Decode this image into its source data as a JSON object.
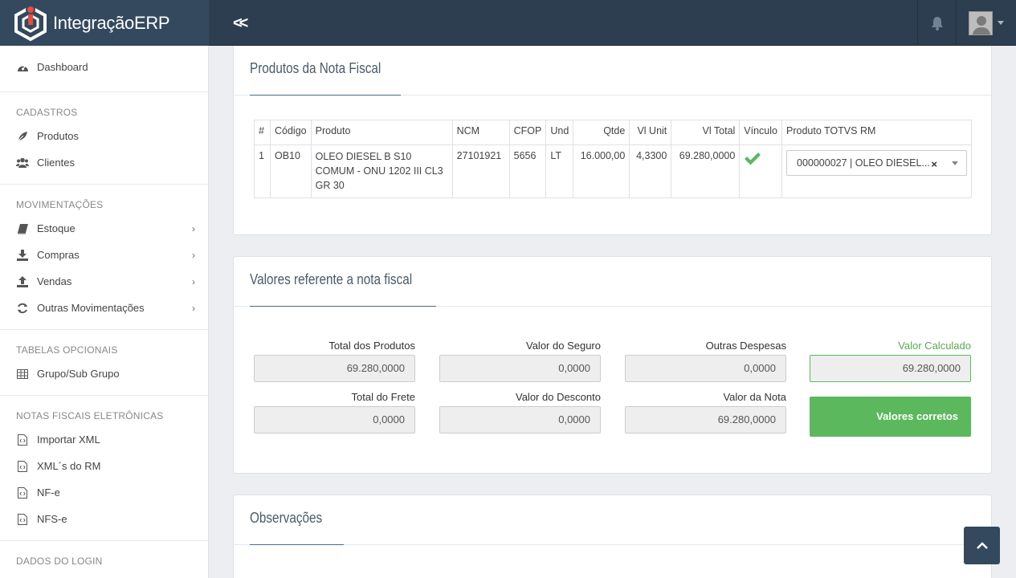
{
  "app": {
    "brand": "IntegraçãoERP",
    "collapse_label": "«"
  },
  "sidebar": {
    "dashboard": "Dashboard",
    "sections": [
      {
        "title": "CADASTROS",
        "items": [
          {
            "label": "Produtos",
            "icon": "leaf-icon"
          },
          {
            "label": "Clientes",
            "icon": "users-icon"
          }
        ]
      },
      {
        "title": "MOVIMENTAÇÕES",
        "items": [
          {
            "label": "Estoque",
            "icon": "book-icon"
          },
          {
            "label": "Compras",
            "icon": "download-icon"
          },
          {
            "label": "Vendas",
            "icon": "upload-icon"
          },
          {
            "label": "Outras Movimentações",
            "icon": "refresh-icon"
          }
        ]
      },
      {
        "title": "TABELAS OPCIONAIS",
        "items": [
          {
            "label": "Grupo/Sub Grupo",
            "icon": "table-icon"
          }
        ]
      },
      {
        "title": "NOTAS FISCAIS ELETRÔNICAS",
        "items": [
          {
            "label": "Importar XML",
            "icon": "file-code-icon"
          },
          {
            "label": "XML´s do RM",
            "icon": "file-code-icon"
          },
          {
            "label": "NF-e",
            "icon": "file-code-icon"
          },
          {
            "label": "NFS-e",
            "icon": "file-code-icon"
          }
        ]
      },
      {
        "title": "DADOS DO LOGIN"
      }
    ]
  },
  "produtos": {
    "title": "Produtos da Nota Fiscal",
    "headers": [
      "#",
      "Código",
      "Produto",
      "NCM",
      "CFOP",
      "Und",
      "Qtde",
      "Vl Unit",
      "Vl Total",
      "Vínculo",
      "Produto TOTVS RM"
    ],
    "row": {
      "num": "1",
      "codigo": "OB10",
      "produto": "OLEO DIESEL B S10 COMUM - ONU 1202 III CL3 GR 30",
      "ncm": "27101921",
      "cfop": "5656",
      "und": "LT",
      "qtde": "16.000,00",
      "vl_unit": "4,3300",
      "vl_total": "69.280,0000",
      "vinculo": "check",
      "totvs": "000000027 | OLEO DIESEL...",
      "clear": "×"
    }
  },
  "valores": {
    "title": "Valores referente a nota fiscal",
    "total_produtos_label": "Total dos Produtos",
    "total_produtos": "69.280,0000",
    "valor_seguro_label": "Valor do Seguro",
    "valor_seguro": "0,0000",
    "outras_despesas_label": "Outras Despesas",
    "outras_despesas": "0,0000",
    "valor_calculado_label": "Valor Calculado",
    "valor_calculado": "69.280,0000",
    "total_frete_label": "Total do Frete",
    "total_frete": "0,0000",
    "valor_desconto_label": "Valor do Desconto",
    "valor_desconto": "0,0000",
    "valor_nota_label": "Valor da Nota",
    "valor_nota": "69.280,0000",
    "ok_button": "Valores corretos"
  },
  "observacoes": {
    "title": "Observações"
  },
  "colors": {
    "accent_green": "#5cb85c",
    "topbar": "#2c3e50",
    "logo_red": "#e74c3c"
  }
}
